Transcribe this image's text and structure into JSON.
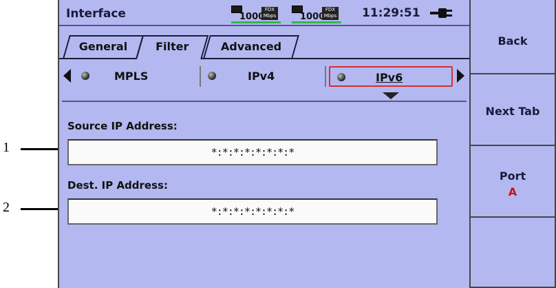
{
  "callouts": [
    {
      "number": "1"
    },
    {
      "number": "2"
    }
  ],
  "status_bar": {
    "title": "Interface",
    "links": [
      {
        "speed": "1000",
        "duplex": "FDX",
        "unit": "Mbps",
        "status_color": "#2fb84a"
      },
      {
        "speed": "1000",
        "duplex": "FDX",
        "unit": "Mbps",
        "status_color": "#2fb84a"
      }
    ],
    "clock": "11:29:51",
    "power_icon": "plug-icon"
  },
  "tabs": [
    {
      "label": "General",
      "selected": false
    },
    {
      "label": "Filter",
      "selected": true
    },
    {
      "label": "Advanced",
      "selected": false
    }
  ],
  "protocols": {
    "items": [
      {
        "label": "MPLS",
        "selected": false
      },
      {
        "label": "IPv4",
        "selected": false
      },
      {
        "label": "IPv6",
        "selected": true
      }
    ],
    "left_arrow_icon": "triangle-left-icon",
    "right_arrow_icon": "triangle-right-icon",
    "highlight_color": "#d03030"
  },
  "fields": {
    "source_label": "Source IP Address:",
    "source_value": "*:*:*:*:*:*:*:*",
    "dest_label": "Dest. IP Address:",
    "dest_value": "*:*:*:*:*:*:*:*"
  },
  "softkeys": {
    "back": "Back",
    "next_tab": "Next Tab",
    "port_label": "Port",
    "port_value": "A",
    "port_value_color": "#cc1111"
  },
  "colors": {
    "background": "#b4b8f0",
    "field_background": "#fafafa"
  }
}
